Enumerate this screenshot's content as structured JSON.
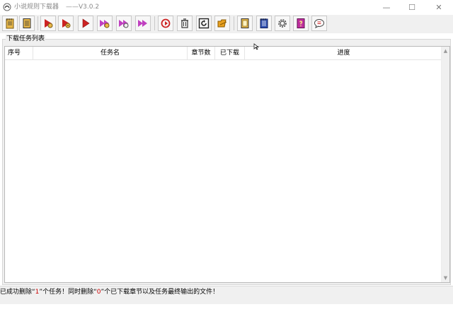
{
  "window": {
    "title": "小说规则下载器",
    "version": "——V3.0.2",
    "controls": {
      "minimize": "—",
      "maximize": "☐",
      "close": "✕"
    }
  },
  "toolbar": {
    "buttons": [
      {
        "name": "new-task",
        "icon": "notepad-icon",
        "color": "#e8b84a"
      },
      {
        "name": "task-list",
        "icon": "book-icon",
        "color": "#e8b84a"
      },
      {
        "name": "start",
        "icon": "play-gear-icon",
        "color": "#cc2222"
      },
      {
        "name": "start-all",
        "icon": "play-gear-star-icon",
        "color": "#cc2222"
      },
      {
        "name": "play",
        "icon": "play-icon",
        "color": "#cc2222"
      },
      {
        "name": "fast-gear",
        "icon": "fast-forward-gear-icon",
        "color": "#c040c0"
      },
      {
        "name": "fast-gear-2",
        "icon": "fast-forward-gear-2-icon",
        "color": "#c040c0"
      },
      {
        "name": "fast-forward",
        "icon": "fast-forward-icon",
        "color": "#c040c0"
      },
      {
        "name": "refresh",
        "icon": "refresh-icon",
        "color": "#cc2222"
      },
      {
        "name": "delete",
        "icon": "trash-icon",
        "color": "#333333"
      },
      {
        "name": "reload",
        "icon": "reload-icon",
        "color": "#222222"
      },
      {
        "name": "open-folder",
        "icon": "folder-icon",
        "color": "#e8a020"
      },
      {
        "name": "rules",
        "icon": "document-icon",
        "color": "#e8b84a"
      },
      {
        "name": "log",
        "icon": "notebook-icon",
        "color": "#3050b0"
      },
      {
        "name": "settings",
        "icon": "gear-icon",
        "color": "#555555"
      },
      {
        "name": "help",
        "icon": "help-book-icon",
        "color": "#c030a0"
      },
      {
        "name": "feedback",
        "icon": "chat-bubble-icon",
        "color": "#cc2222"
      }
    ]
  },
  "task_group": {
    "label": "下载任务列表",
    "columns": [
      "序号",
      "任务名",
      "章节数",
      "已下载",
      "进度"
    ]
  },
  "statusbar": {
    "prefix": "已成功删除“",
    "count": "1",
    "middle": "”个任务！同时删除“",
    "count2": "0",
    "suffix": "”个已下载章节以及任务最终输出的文件！"
  }
}
